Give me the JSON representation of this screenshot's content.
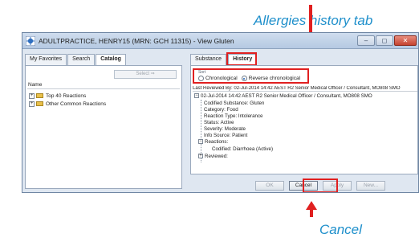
{
  "callouts": {
    "top": "Allergies history tab",
    "bottom": "Cancel"
  },
  "window": {
    "title": "ADULTPRACTICE, HENRY15 (MRN: GCH 11315) - View Gluten",
    "controls": [
      "–",
      "◻",
      "✕"
    ]
  },
  "left_pane": {
    "tabs": [
      "My Favorites",
      "Search",
      "Catalog"
    ],
    "active_tab": "Catalog",
    "select_button": "Select ⇒",
    "column_header": "Name",
    "tree": [
      "Top 40 Reactions",
      "Other Common Reactions"
    ]
  },
  "right_pane": {
    "tabs": [
      "Substance",
      "History"
    ],
    "active_tab": "History",
    "sort": {
      "legend": "Sort",
      "options": [
        "Chronological",
        "Reverse chronological"
      ],
      "selected": "Reverse chronological"
    },
    "last_reviewed": "Last Reviewed By:  02-Jul-2014 14:42 AEST R2 Senior Medical Officer / Consultant, MO808 SMO",
    "history_entry": {
      "header": "02-Jul-2014 14:42 AEST R2 Senior Medical Officer / Consultant, MO808 SMO",
      "lines": [
        "Codified Substance: Gluten",
        "Category: Food",
        "Reaction Type: Intolerance",
        "Status: Active",
        "Severity: Moderate",
        "Info Source: Patient"
      ],
      "reactions_label": "Reactions:",
      "reaction": "Codified: Diarrhoea (Active)",
      "reviewed_label": "Reviewed:"
    }
  },
  "buttons": {
    "ok": "OK",
    "cancel": "Cancel",
    "apply": "Apply",
    "new": "New..."
  },
  "colors": {
    "callout_text": "#1e8fcb",
    "highlight": "#e02020"
  }
}
